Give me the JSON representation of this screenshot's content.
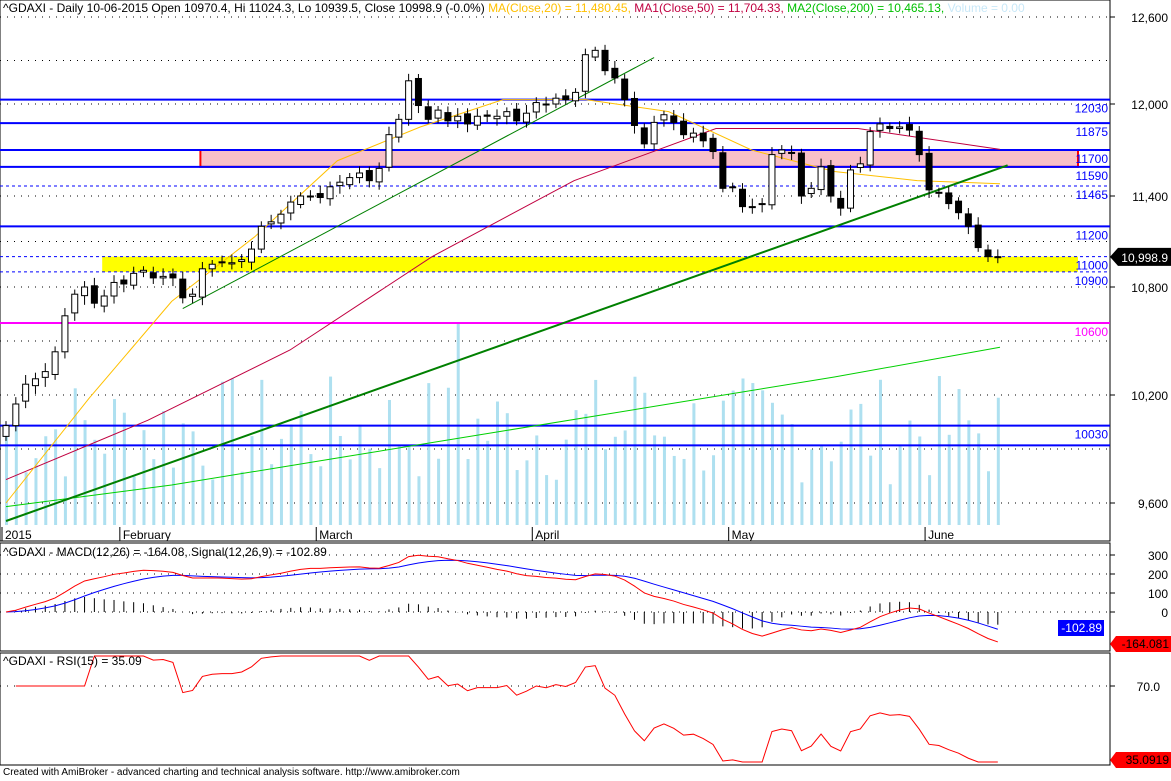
{
  "header": {
    "main": "^GDAXI - Daily 10-06-2015 Open 10970.4, Hi 11024.3, Lo 10939.5, Close 10998.9 (-0.0%)",
    "ma20": "MA(Close,20) = 11,480.45,",
    "ma50": "MA1(Close,50) = 11,704.33,",
    "ma200": "MA2(Close,200) = 10,465.13,",
    "volume": "Volume = 0.00",
    "macd_title": "^GDAXI - MACD(12,26) = -164.08, Signal(12,26,9) = -102.89",
    "rsi_title": "^GDAXI - RSI(15) = 35.09"
  },
  "footer": "Created with AmiBroker - advanced charting and technical analysis software. http://www.amibroker.com",
  "colors": {
    "ma20": "#ffc000",
    "ma50": "#c00040",
    "ma200": "#00d000",
    "macd": "#ff0000",
    "signal": "#0000ff",
    "volume": "#aee0f0",
    "level": "#0000ff",
    "pink": "#f8c0c8",
    "yellow": "#ffff00",
    "magenta": "#ff00ff"
  },
  "chart_data": [
    {
      "type": "candlestick",
      "title": "^GDAXI Daily",
      "x_ticks": [
        "2015",
        "February",
        "March",
        "April",
        "May",
        "June"
      ],
      "x_tick_index": [
        0,
        12,
        32,
        54,
        74,
        94
      ],
      "y_ticks": [
        "12,600",
        "12,000",
        "11,400",
        "10,800",
        "10,200",
        "9,600"
      ],
      "y_tick_values": [
        12600,
        12000,
        11400,
        10800,
        10200,
        9600
      ],
      "last_price_label": "10,998.9",
      "close": [
        10030,
        10150,
        10260,
        10290,
        10330,
        10440,
        10640,
        10760,
        10800,
        10710,
        10750,
        10830,
        10820,
        10890,
        10910,
        10860,
        10870,
        10860,
        10740,
        10760,
        10920,
        10950,
        10960,
        10960,
        10980,
        11050,
        11200,
        11230,
        11280,
        11360,
        11400,
        11400,
        11390,
        11460,
        11490,
        11520,
        11550,
        11500,
        11580,
        11800,
        11900,
        12160,
        11990,
        11900,
        11960,
        11890,
        11920,
        11870,
        11920,
        11920,
        11920,
        11950,
        11890,
        11940,
        12010,
        12000,
        12040,
        12030,
        12080,
        12340,
        12370,
        12230,
        12180,
        12030,
        11860,
        11740,
        11880,
        11930,
        11880,
        11800,
        11810,
        11760,
        11690,
        11450,
        11460,
        11330,
        11330,
        11350,
        11670,
        11700,
        11680,
        11400,
        11450,
        11590,
        11400,
        11320,
        11570,
        11610,
        11820,
        11870,
        11840,
        11850,
        11830,
        11670,
        11440,
        11420,
        11350,
        11290,
        11200,
        11060,
        11000,
        10999
      ],
      "ma20": [
        9600,
        10180,
        10720,
        11130,
        11630,
        11850,
        12030,
        12030,
        11950,
        11700,
        11560,
        11500,
        11480
      ],
      "ma50": [
        9730,
        10060,
        10450,
        11000,
        11500,
        11840,
        11840,
        11704
      ],
      "ma200": [
        9580,
        9700,
        9850,
        10000,
        10150,
        10300,
        10465
      ],
      "levels": [
        {
          "value": 12030,
          "label": "12030",
          "style": "solid"
        },
        {
          "value": 11875,
          "label": "11875",
          "style": "solid"
        },
        {
          "value": 11700,
          "label": "11700",
          "style": "solid"
        },
        {
          "value": 11590,
          "label": "11590",
          "style": "solid"
        },
        {
          "value": 11465,
          "label": "11465",
          "style": "dashed"
        },
        {
          "value": 11200,
          "label": "11200",
          "style": "solid"
        },
        {
          "value": 11000,
          "label": "11000",
          "style": "dashed"
        },
        {
          "value": 10900,
          "label": "10900",
          "style": "dashed"
        },
        {
          "value": 10600,
          "label": "10600",
          "style": "magenta"
        },
        {
          "value": 10030,
          "label": "10030",
          "style": "solid"
        },
        {
          "value": 9920,
          "label": "",
          "style": "solid"
        }
      ],
      "zones": [
        {
          "from": 11590,
          "to": 11700,
          "color": "pink",
          "start_index": 20
        },
        {
          "from": 10900,
          "to": 11000,
          "color": "yellow",
          "start_index": 10
        }
      ],
      "trendlines": [
        {
          "from": [
            18,
            10680
          ],
          "to": [
            66,
            12320
          ],
          "color": "green-thin"
        },
        {
          "from": [
            0,
            9500
          ],
          "to": [
            102,
            11600
          ],
          "color": "green-thick"
        }
      ]
    },
    {
      "type": "line",
      "title": "MACD(12,26)",
      "y_ticks": [
        "300",
        "200",
        "100",
        "0"
      ],
      "y_tick_values": [
        300,
        200,
        100,
        0
      ],
      "macd_label": "-164.081",
      "signal_label": "-102.89"
    },
    {
      "type": "line",
      "title": "RSI(15)",
      "y_ticks": [
        "70.0"
      ],
      "y_tick_values": [
        70
      ],
      "rsi_label": "35.0919"
    }
  ]
}
